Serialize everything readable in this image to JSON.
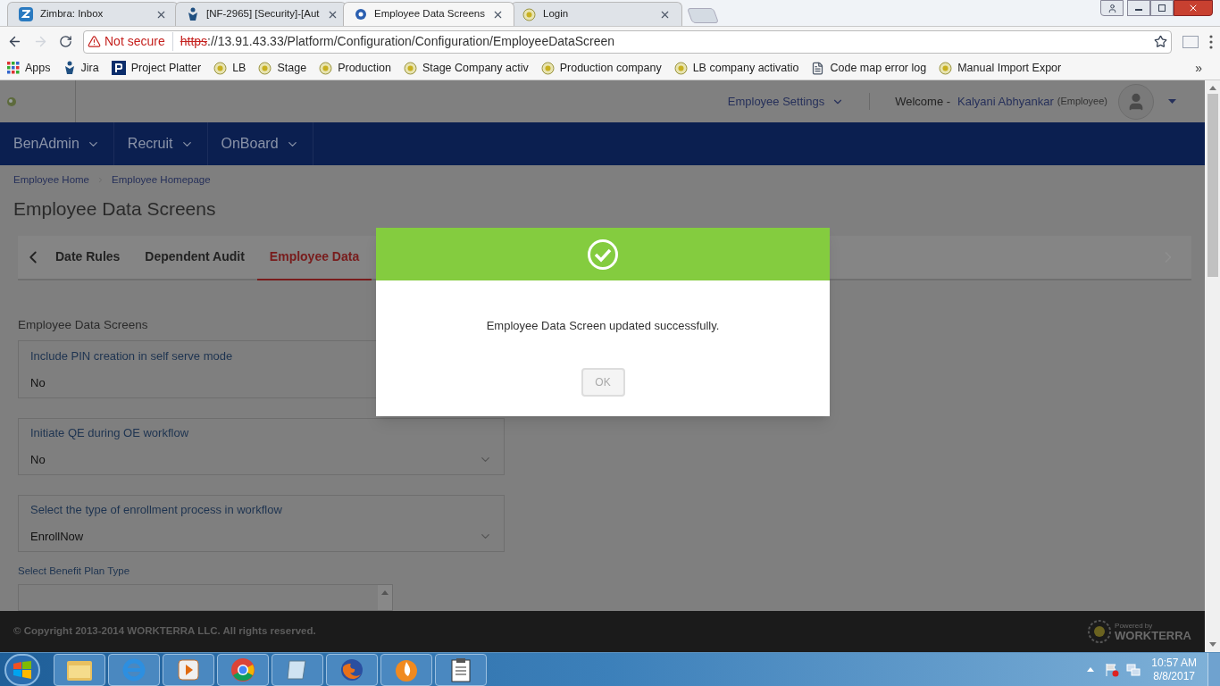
{
  "browser": {
    "tabs": [
      {
        "title": "Zimbra: Inbox",
        "kind": "zimbra",
        "selected": false
      },
      {
        "title": "[NF-2965] [Security]-[Aut",
        "kind": "jira",
        "selected": false
      },
      {
        "title": "Employee Data Screens",
        "kind": "page",
        "selected": true
      },
      {
        "title": "Login",
        "kind": "site",
        "selected": false
      }
    ],
    "address": {
      "warning": "Not secure",
      "scheme": "https",
      "rest": "://13.91.43.33/Platform/Configuration/Configuration/EmployeeDataScreen"
    },
    "bookmarks": [
      {
        "label": "Apps",
        "kind": "apps"
      },
      {
        "label": "Jira",
        "kind": "jira"
      },
      {
        "label": "Project Platter",
        "kind": "p"
      },
      {
        "label": "LB",
        "kind": "site"
      },
      {
        "label": "Stage",
        "kind": "site"
      },
      {
        "label": "Production",
        "kind": "site"
      },
      {
        "label": "Stage Company activ",
        "kind": "site"
      },
      {
        "label": "Production company",
        "kind": "site"
      },
      {
        "label": "LB company activatio",
        "kind": "site"
      },
      {
        "label": "Code map error log",
        "kind": "doc"
      },
      {
        "label": "Manual Import Expor",
        "kind": "site"
      }
    ],
    "overflow": "»"
  },
  "header": {
    "settings": "Employee Settings",
    "welcome": "Welcome -",
    "user": "Kalyani Abhyankar",
    "role": "(Employee)"
  },
  "nav": [
    "BenAdmin",
    "Recruit",
    "OnBoard"
  ],
  "breadcrumbs": [
    "Employee Home",
    "Employee Homepage"
  ],
  "title": "Employee Data Screens",
  "tabs": [
    {
      "label": "Date Rules",
      "selected": false
    },
    {
      "label": "Dependent Audit",
      "selected": false
    },
    {
      "label": "Employee Data",
      "selected": true
    }
  ],
  "section_title": "Employee Data Screens",
  "fields": [
    {
      "label": "Include PIN creation in self serve mode",
      "value": "No",
      "kind": "plain"
    },
    {
      "label": "Initiate QE during OE workflow",
      "value": "No",
      "kind": "select"
    },
    {
      "label": "Select the type of enrollment process in workflow",
      "value": "EnrollNow",
      "kind": "select"
    }
  ],
  "plan_type_label": "Select Benefit Plan Type",
  "footer": {
    "copyright": "© Copyright 2013-2014 WORKTERRA LLC. All rights reserved.",
    "powered": "Powered by",
    "brand": "WORKTERRA"
  },
  "modal": {
    "message": "Employee Data Screen updated successfully.",
    "button": "OK"
  },
  "taskbar": {
    "apps": [
      {
        "kind": "folder"
      },
      {
        "kind": "ie"
      },
      {
        "kind": "media"
      },
      {
        "kind": "chrome"
      },
      {
        "kind": "notepad"
      },
      {
        "kind": "firefox"
      },
      {
        "kind": "flame"
      },
      {
        "kind": "clipboard"
      }
    ],
    "time": "10:57 AM",
    "date": "8/8/2017"
  }
}
